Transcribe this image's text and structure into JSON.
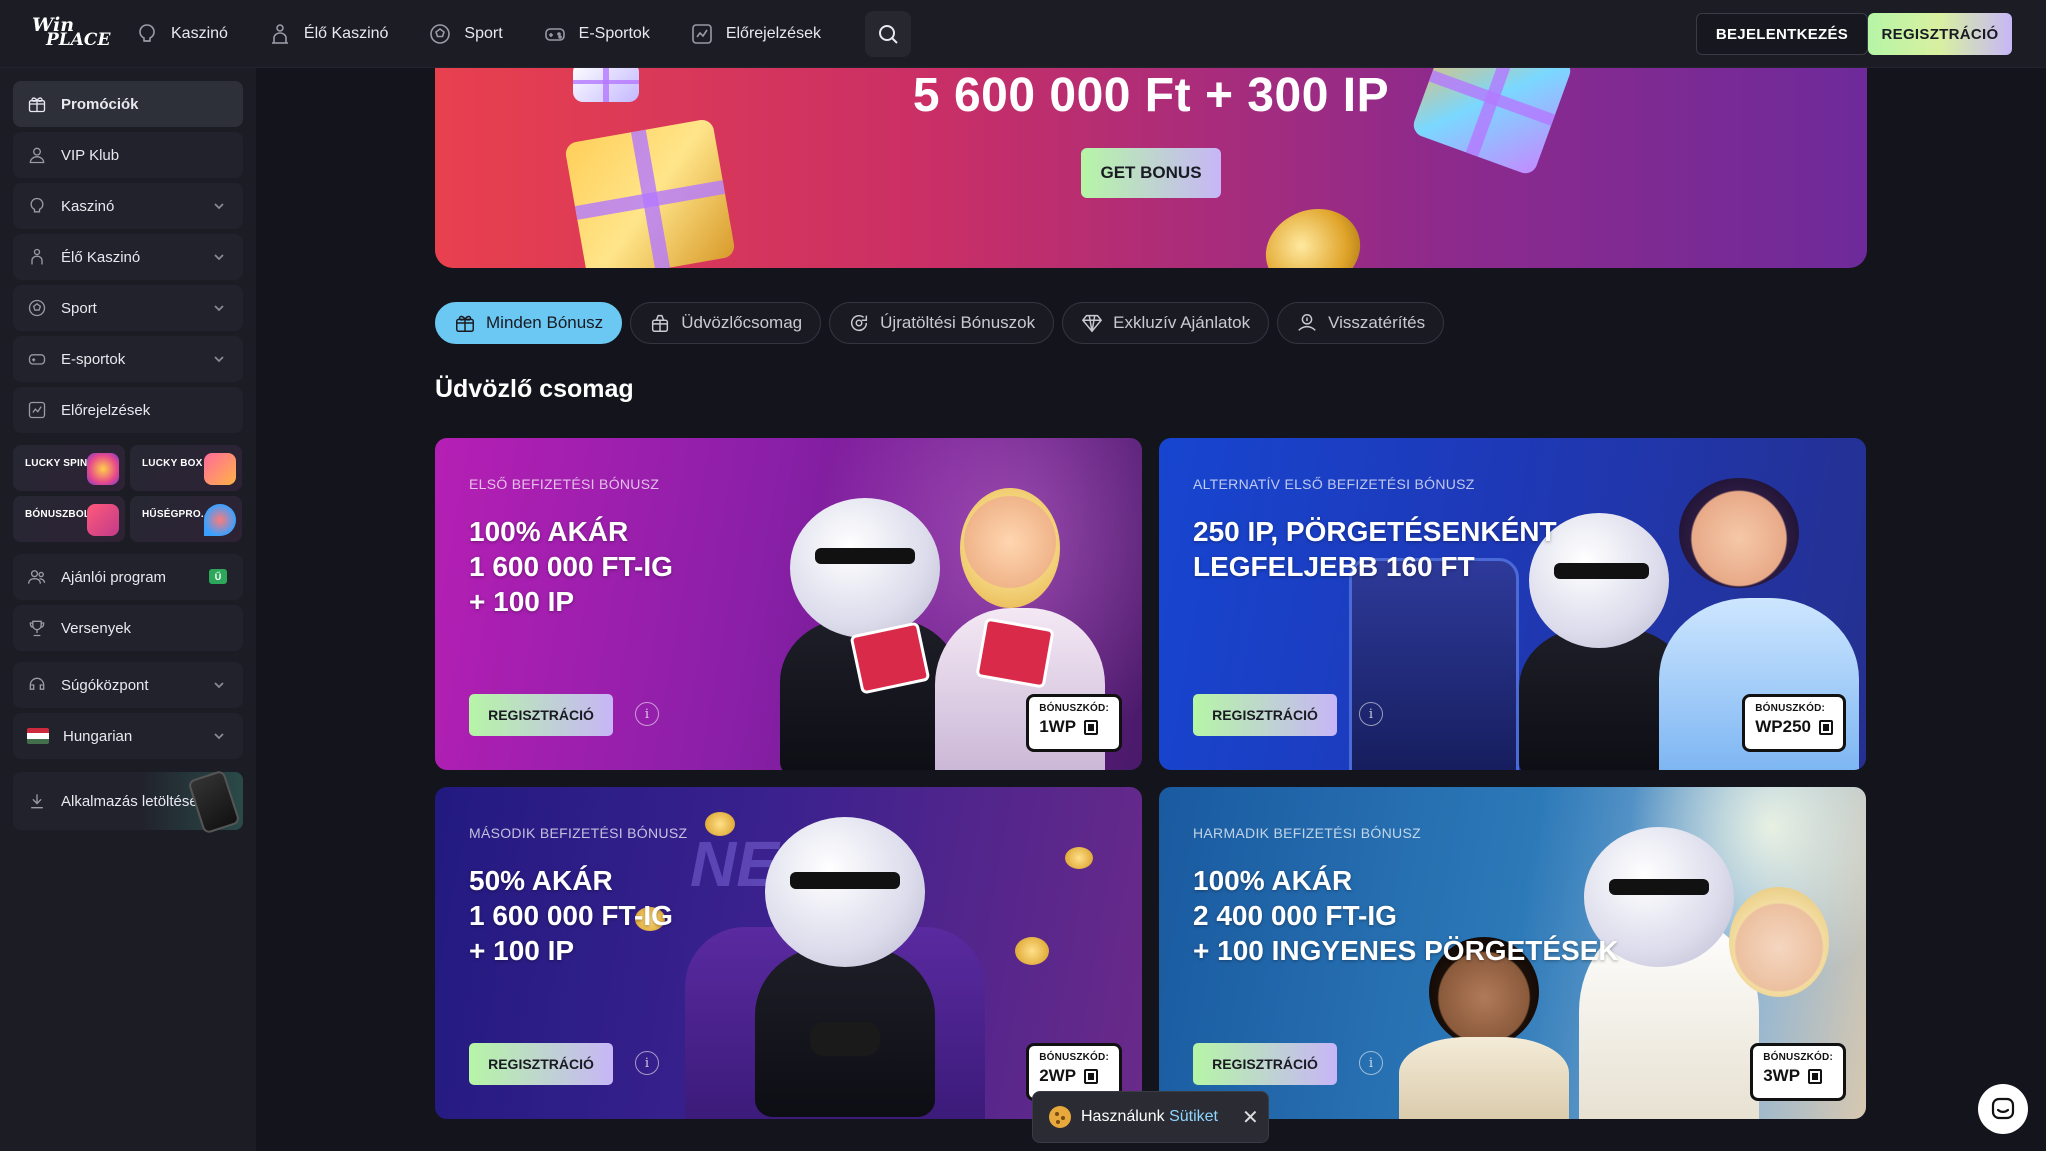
{
  "brand": {
    "logo_line1": "Win",
    "logo_line2": "PLACE"
  },
  "nav": [
    {
      "label": "Kaszinó",
      "icon": "casino-icon"
    },
    {
      "label": "Élő Kaszinó",
      "icon": "live-dealer-icon"
    },
    {
      "label": "Sport",
      "icon": "football-icon"
    },
    {
      "label": "E-Sportok",
      "icon": "gamepad-icon"
    },
    {
      "label": "Előrejelzések",
      "icon": "chart-icon"
    }
  ],
  "header": {
    "login_label": "BEJELENTKEZÉS",
    "register_label": "REGISZTRÁCIÓ"
  },
  "sidebar": {
    "items": [
      {
        "label": "Promóciók",
        "icon": "gift-icon",
        "active": true
      },
      {
        "label": "VIP Klub",
        "icon": "vip-icon"
      },
      {
        "label": "Kaszinó",
        "icon": "casino-icon",
        "expandable": true
      },
      {
        "label": "Élő Kaszinó",
        "icon": "live-dealer-icon",
        "expandable": true
      },
      {
        "label": "Sport",
        "icon": "football-icon",
        "expandable": true
      },
      {
        "label": "E-sportok",
        "icon": "gamepad-icon",
        "expandable": true
      },
      {
        "label": "Előrejelzések",
        "icon": "chart-icon"
      }
    ],
    "tiles": [
      "LUCKY SPIN",
      "LUCKY BOX",
      "BÓNUSZBOLT",
      "HŰSÉGPRO..."
    ],
    "items2": [
      {
        "label": "Ajánlói program",
        "icon": "referral-icon",
        "badge": "Ű"
      },
      {
        "label": "Versenyek",
        "icon": "trophy-icon"
      },
      {
        "label": "Súgóközpont",
        "icon": "help-icon",
        "expandable": true
      },
      {
        "label": "Hungarian",
        "icon": "hungary-flag-icon",
        "expandable": true
      }
    ],
    "app_download": "Alkalmazás letöltése"
  },
  "hero": {
    "amount": "5 600 000 Ft + 300 IP",
    "cta": "GET BONUS"
  },
  "tabs": [
    {
      "label": "Minden Bónusz",
      "icon": "gift-icon",
      "active": true
    },
    {
      "label": "Üdvözlőcsomag",
      "icon": "package-icon"
    },
    {
      "label": "Újratöltési Bónuszok",
      "icon": "reload-icon"
    },
    {
      "label": "Exkluzív Ajánlatok",
      "icon": "diamond-icon"
    },
    {
      "label": "Visszatérítés",
      "icon": "cashback-icon"
    }
  ],
  "section_title": "Üdvözlő csomag",
  "cards": [
    {
      "subtitle": "ELSŐ BEFIZETÉSI BÓNUSZ",
      "headline": "100% AKÁR\n1 600 000 FT-IG\n+ 100 IP",
      "cta": "REGISZTRÁCIÓ",
      "code_label": "BÓNUSZKÓD:",
      "code": "1WP",
      "colors": [
        "#a322b8",
        "#6c1f9a"
      ]
    },
    {
      "subtitle": "ALTERNATÍV ELSŐ BEFIZETÉSI BÓNUSZ",
      "headline": "250 IP, PÖRGETÉSENKÉNT\nLEGFELJEBB 160 FT",
      "cta": "REGISZTRÁCIÓ",
      "code_label": "BÓNUSZKÓD:",
      "code": "WP250",
      "colors": [
        "#1a46c9",
        "#2a2f9a"
      ]
    },
    {
      "subtitle": "MÁSODIK BEFIZETÉSI BÓNUSZ",
      "headline": "50% AKÁR\n1 600 000 FT-IG\n+ 100 IP",
      "cta": "REGISZTRÁCIÓ",
      "code_label": "BÓNUSZKÓD:",
      "code": "2WP",
      "colors": [
        "#2b1f86",
        "#5a2690"
      ]
    },
    {
      "subtitle": "HARMADIK BEFIZETÉSI BÓNUSZ",
      "headline": "100% AKÁR\n2 400 000 FT-IG\n+ 100 INGYENES PÖRGETÉSEK",
      "cta": "REGISZTRÁCIÓ",
      "code_label": "BÓNUSZKÓD:",
      "code": "3WP",
      "colors": [
        "#1b5f9c",
        "#2d7bb8"
      ]
    }
  ],
  "cookie": {
    "text": "Használunk",
    "link": "Sütiket"
  }
}
